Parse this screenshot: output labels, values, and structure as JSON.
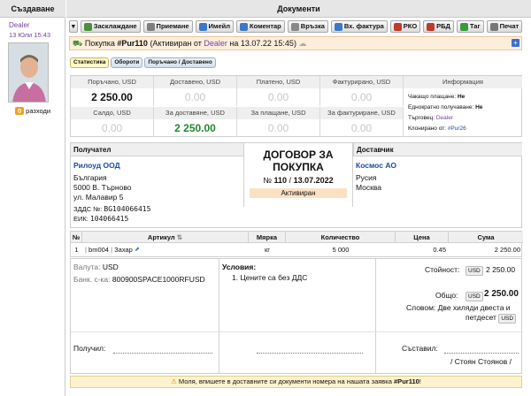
{
  "left_panel": {
    "header": "Създаване",
    "creator": "Dealer",
    "created": "13 Юли 15:43",
    "expenses_count": "0",
    "expenses_label": "разходи"
  },
  "main": {
    "header": "Документи"
  },
  "toolbar": [
    {
      "label": "Засклаждане",
      "icon": "warehouse-icon",
      "color": "#4a8f3a"
    },
    {
      "label": "Приемане",
      "icon": "receive-icon",
      "color": "#7f7f7f"
    },
    {
      "label": "Имейл",
      "icon": "email-icon",
      "color": "#3c78c8"
    },
    {
      "label": "Коментар",
      "icon": "comment-icon",
      "color": "#3c78c8"
    },
    {
      "label": "Връзка",
      "icon": "link-icon",
      "color": "#888888"
    },
    {
      "label": "Вх. фактура",
      "icon": "invoice-icon",
      "color": "#3c78c8"
    },
    {
      "label": "РКО",
      "icon": "cash-icon",
      "color": "#c0392b"
    },
    {
      "label": "РБД",
      "icon": "bank-icon",
      "color": "#c0392b"
    },
    {
      "label": "Таг",
      "icon": "tag-icon",
      "color": "#3a9a3a"
    },
    {
      "label": "Печат",
      "icon": "print-icon",
      "color": "#777777"
    }
  ],
  "title": {
    "prefix": "Покупка",
    "number": "#Pur110",
    "state_text": "(Активиран от",
    "user": "Dealer",
    "date_text": "на 13.07.22 15:45)"
  },
  "tabs": [
    "Статистика",
    "Обороти",
    "Поръчано / Доставено"
  ],
  "stats": {
    "row1": [
      {
        "label": "Поръчано, USD",
        "value": "2 250.00"
      },
      {
        "label": "Доставено, USD",
        "value": "0.00"
      },
      {
        "label": "Платено, USD",
        "value": "0.00"
      },
      {
        "label": "Фактурирано, USD",
        "value": "0.00"
      }
    ],
    "row2": [
      {
        "label": "Салдо, USD",
        "value": "0.00"
      },
      {
        "label": "За доставяне, USD",
        "value": "2 250.00"
      },
      {
        "label": "За плащане, USD",
        "value": "0.00"
      },
      {
        "label": "За фактуриране, USD",
        "value": "0.00"
      }
    ],
    "info_header": "Информация",
    "info": {
      "pending_pay_label": "Чакащо плащане:",
      "pending_pay_value": "Не",
      "single_receive_label": "Еднократно получаване:",
      "single_receive_value": "Не",
      "dealer_label": "Търговец:",
      "dealer_value": "Dealer",
      "cloned_label": "Клонирано от:",
      "cloned_value": "#Pur26"
    }
  },
  "parties": {
    "recipient_header": "Получател",
    "recipient_name": "Рилоуд ООД",
    "recipient_country": "България",
    "recipient_city": "5000 В. Търново",
    "recipient_street": "ул. Малавир 5",
    "recipient_vat_label": "ЗДДС №:",
    "recipient_vat": "BG104066415",
    "recipient_eik_label": "ЕИК:",
    "recipient_eik": "104066415",
    "doc_title_1": "ДОГОВОР ЗА",
    "doc_title_2": "ПОКУПКА",
    "doc_no_label": "№",
    "doc_no": "110",
    "doc_sep": "/",
    "doc_date": "13.07.2022",
    "doc_state": "Активиран",
    "supplier_header": "Доставчик",
    "supplier_name": "Космос АО",
    "supplier_country": "Русия",
    "supplier_city": "Москва"
  },
  "items": {
    "headers": [
      "№",
      "Артикул",
      "Мярка",
      "Количество",
      "Цена",
      "Сума"
    ],
    "rows": [
      {
        "no": "1",
        "code": "bm004",
        "name": "Захар",
        "unit": "кг",
        "qty": "5 000",
        "price": "0.45",
        "sum": "2 250.00"
      }
    ]
  },
  "footer": {
    "currency_label": "Валута:",
    "currency_value": "USD",
    "bank_label": "Банк. с-ка:",
    "bank_value": "800900SPACE1000RFUSD",
    "conditions_label": "Условия:",
    "condition_1": "1. Цените са без ДДС",
    "value_label": "Стойност:",
    "value_cur": "USD",
    "value_amount": "2 250.00",
    "total_label": "Общо:",
    "total_cur": "USD",
    "total_amount": "2 250.00",
    "words_label": "Словом:",
    "words_text_1": "Две хиляди двеста и",
    "words_text_2": "петдесет",
    "words_cur": "USD",
    "received_label": "Получил:",
    "composed_label": "Съставил:",
    "composed_name": "/ Стоян Стоянов /"
  },
  "notice": {
    "text": "Моля, впишете в доставните си документи номера на нашата заявка",
    "ref": "#Pur110",
    "suffix": "!"
  },
  "colors": {
    "title_bg": "#fdeeda",
    "link": "#1d4aa0",
    "positive": "#1f8a2a",
    "dealer": "#7a3fa0"
  }
}
